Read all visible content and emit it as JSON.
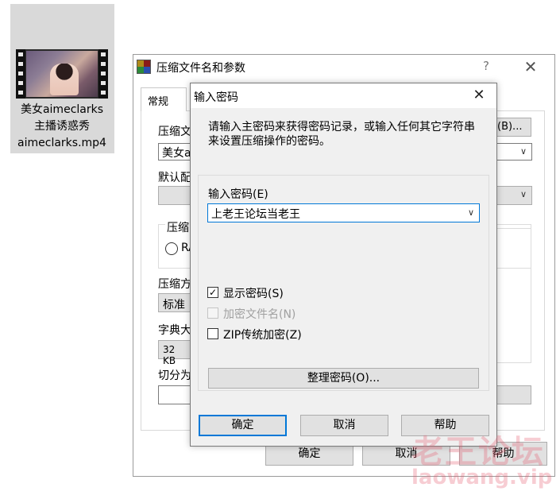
{
  "desktop": {
    "file_name_lines": [
      "美女aimeclarks",
      "主播诱惑秀",
      "aimeclarks.mp4"
    ]
  },
  "main_dialog": {
    "title": "压缩文件名和参数",
    "help_glyph": "?",
    "close_glyph": "✕",
    "tab_general": "常规",
    "archive_name_label": "压缩文",
    "archive_name_value": "美女a",
    "browse_button": "(B)...",
    "profile_label": "默认配",
    "format_label": "压缩",
    "radio_rar_label": "RA",
    "method_label": "压缩方",
    "method_value": "标准",
    "dict_label": "字典大",
    "dict_value": "32 KB",
    "split_label": "切分为",
    "ok_button": "确定",
    "cancel_button": "取消",
    "help_button": "帮助"
  },
  "password_dialog": {
    "title": "输入密码",
    "close_glyph": "✕",
    "intro_text": "请输入主密码来获得密码记录，或输入任何其它字符串来设置压缩操作的密码。",
    "password_label": "输入密码(E)",
    "password_value": "上老王论坛当老王",
    "show_password_label": "显示密码(S)",
    "show_password_checked": true,
    "encrypt_filenames_label": "加密文件名(N)",
    "encrypt_filenames_enabled": false,
    "zip_legacy_label": "ZIP传统加密(Z)",
    "organize_button": "整理密码(O)...",
    "ok_button": "确定",
    "cancel_button": "取消",
    "help_button": "帮助"
  },
  "watermark": {
    "cn": "老王论坛",
    "en": "laowang.vip"
  }
}
